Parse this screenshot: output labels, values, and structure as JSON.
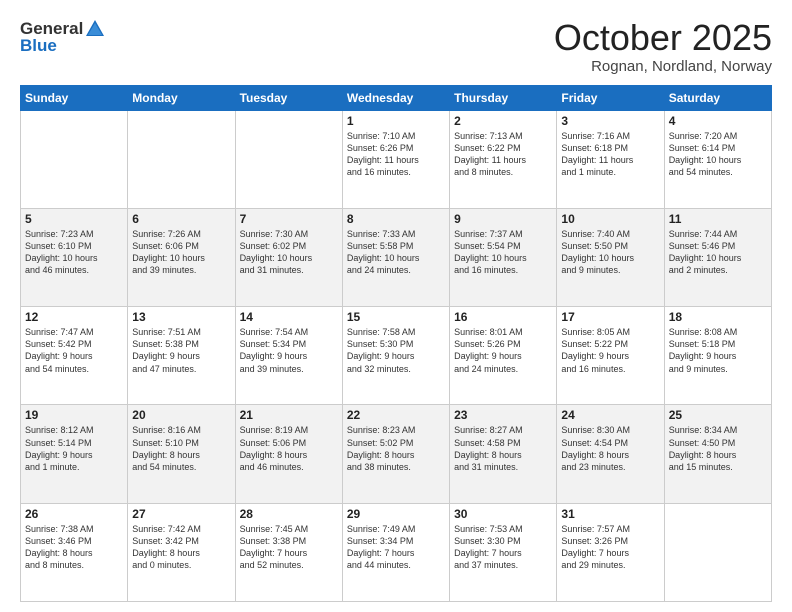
{
  "logo": {
    "general": "General",
    "blue": "Blue"
  },
  "header": {
    "month": "October 2025",
    "location": "Rognan, Nordland, Norway"
  },
  "days_of_week": [
    "Sunday",
    "Monday",
    "Tuesday",
    "Wednesday",
    "Thursday",
    "Friday",
    "Saturday"
  ],
  "weeks": [
    [
      {
        "day": "",
        "info": ""
      },
      {
        "day": "",
        "info": ""
      },
      {
        "day": "",
        "info": ""
      },
      {
        "day": "1",
        "info": "Sunrise: 7:10 AM\nSunset: 6:26 PM\nDaylight: 11 hours\nand 16 minutes."
      },
      {
        "day": "2",
        "info": "Sunrise: 7:13 AM\nSunset: 6:22 PM\nDaylight: 11 hours\nand 8 minutes."
      },
      {
        "day": "3",
        "info": "Sunrise: 7:16 AM\nSunset: 6:18 PM\nDaylight: 11 hours\nand 1 minute."
      },
      {
        "day": "4",
        "info": "Sunrise: 7:20 AM\nSunset: 6:14 PM\nDaylight: 10 hours\nand 54 minutes."
      }
    ],
    [
      {
        "day": "5",
        "info": "Sunrise: 7:23 AM\nSunset: 6:10 PM\nDaylight: 10 hours\nand 46 minutes."
      },
      {
        "day": "6",
        "info": "Sunrise: 7:26 AM\nSunset: 6:06 PM\nDaylight: 10 hours\nand 39 minutes."
      },
      {
        "day": "7",
        "info": "Sunrise: 7:30 AM\nSunset: 6:02 PM\nDaylight: 10 hours\nand 31 minutes."
      },
      {
        "day": "8",
        "info": "Sunrise: 7:33 AM\nSunset: 5:58 PM\nDaylight: 10 hours\nand 24 minutes."
      },
      {
        "day": "9",
        "info": "Sunrise: 7:37 AM\nSunset: 5:54 PM\nDaylight: 10 hours\nand 16 minutes."
      },
      {
        "day": "10",
        "info": "Sunrise: 7:40 AM\nSunset: 5:50 PM\nDaylight: 10 hours\nand 9 minutes."
      },
      {
        "day": "11",
        "info": "Sunrise: 7:44 AM\nSunset: 5:46 PM\nDaylight: 10 hours\nand 2 minutes."
      }
    ],
    [
      {
        "day": "12",
        "info": "Sunrise: 7:47 AM\nSunset: 5:42 PM\nDaylight: 9 hours\nand 54 minutes."
      },
      {
        "day": "13",
        "info": "Sunrise: 7:51 AM\nSunset: 5:38 PM\nDaylight: 9 hours\nand 47 minutes."
      },
      {
        "day": "14",
        "info": "Sunrise: 7:54 AM\nSunset: 5:34 PM\nDaylight: 9 hours\nand 39 minutes."
      },
      {
        "day": "15",
        "info": "Sunrise: 7:58 AM\nSunset: 5:30 PM\nDaylight: 9 hours\nand 32 minutes."
      },
      {
        "day": "16",
        "info": "Sunrise: 8:01 AM\nSunset: 5:26 PM\nDaylight: 9 hours\nand 24 minutes."
      },
      {
        "day": "17",
        "info": "Sunrise: 8:05 AM\nSunset: 5:22 PM\nDaylight: 9 hours\nand 16 minutes."
      },
      {
        "day": "18",
        "info": "Sunrise: 8:08 AM\nSunset: 5:18 PM\nDaylight: 9 hours\nand 9 minutes."
      }
    ],
    [
      {
        "day": "19",
        "info": "Sunrise: 8:12 AM\nSunset: 5:14 PM\nDaylight: 9 hours\nand 1 minute."
      },
      {
        "day": "20",
        "info": "Sunrise: 8:16 AM\nSunset: 5:10 PM\nDaylight: 8 hours\nand 54 minutes."
      },
      {
        "day": "21",
        "info": "Sunrise: 8:19 AM\nSunset: 5:06 PM\nDaylight: 8 hours\nand 46 minutes."
      },
      {
        "day": "22",
        "info": "Sunrise: 8:23 AM\nSunset: 5:02 PM\nDaylight: 8 hours\nand 38 minutes."
      },
      {
        "day": "23",
        "info": "Sunrise: 8:27 AM\nSunset: 4:58 PM\nDaylight: 8 hours\nand 31 minutes."
      },
      {
        "day": "24",
        "info": "Sunrise: 8:30 AM\nSunset: 4:54 PM\nDaylight: 8 hours\nand 23 minutes."
      },
      {
        "day": "25",
        "info": "Sunrise: 8:34 AM\nSunset: 4:50 PM\nDaylight: 8 hours\nand 15 minutes."
      }
    ],
    [
      {
        "day": "26",
        "info": "Sunrise: 7:38 AM\nSunset: 3:46 PM\nDaylight: 8 hours\nand 8 minutes."
      },
      {
        "day": "27",
        "info": "Sunrise: 7:42 AM\nSunset: 3:42 PM\nDaylight: 8 hours\nand 0 minutes."
      },
      {
        "day": "28",
        "info": "Sunrise: 7:45 AM\nSunset: 3:38 PM\nDaylight: 7 hours\nand 52 minutes."
      },
      {
        "day": "29",
        "info": "Sunrise: 7:49 AM\nSunset: 3:34 PM\nDaylight: 7 hours\nand 44 minutes."
      },
      {
        "day": "30",
        "info": "Sunrise: 7:53 AM\nSunset: 3:30 PM\nDaylight: 7 hours\nand 37 minutes."
      },
      {
        "day": "31",
        "info": "Sunrise: 7:57 AM\nSunset: 3:26 PM\nDaylight: 7 hours\nand 29 minutes."
      },
      {
        "day": "",
        "info": ""
      }
    ]
  ]
}
